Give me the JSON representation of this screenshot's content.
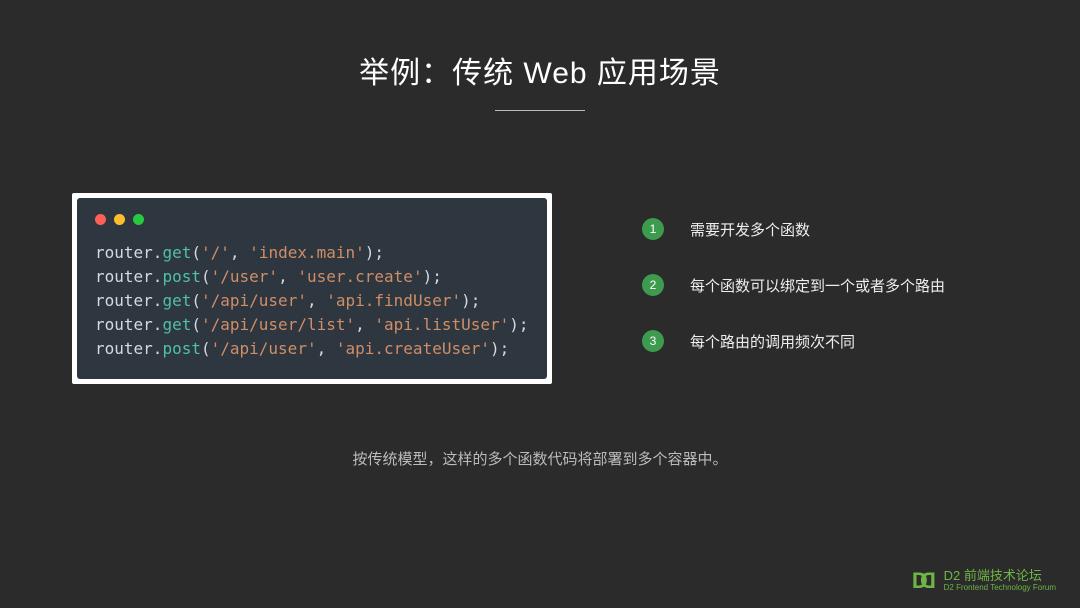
{
  "title": "举例：传统 Web 应用场景",
  "code": [
    {
      "obj": "router",
      "method": "get",
      "arg1": "/",
      "arg2": "index.main"
    },
    {
      "obj": "router",
      "method": "post",
      "arg1": "/user",
      "arg2": "user.create"
    },
    {
      "obj": "router",
      "method": "get",
      "arg1": "/api/user",
      "arg2": "api.findUser"
    },
    {
      "obj": "router",
      "method": "get",
      "arg1": "/api/user/list",
      "arg2": "api.listUser"
    },
    {
      "obj": "router",
      "method": "post",
      "arg1": "/api/user",
      "arg2": "api.createUser"
    }
  ],
  "bullets": [
    {
      "num": "1",
      "text": "需要开发多个函数"
    },
    {
      "num": "2",
      "text": "每个函数可以绑定到一个或者多个路由"
    },
    {
      "num": "3",
      "text": "每个路由的调用频次不同"
    }
  ],
  "caption": "按传统模型，这样的多个函数代码将部署到多个容器中。",
  "footer": {
    "main": "D2 前端技术论坛",
    "sub": "D2 Frontend Technology Forum"
  }
}
